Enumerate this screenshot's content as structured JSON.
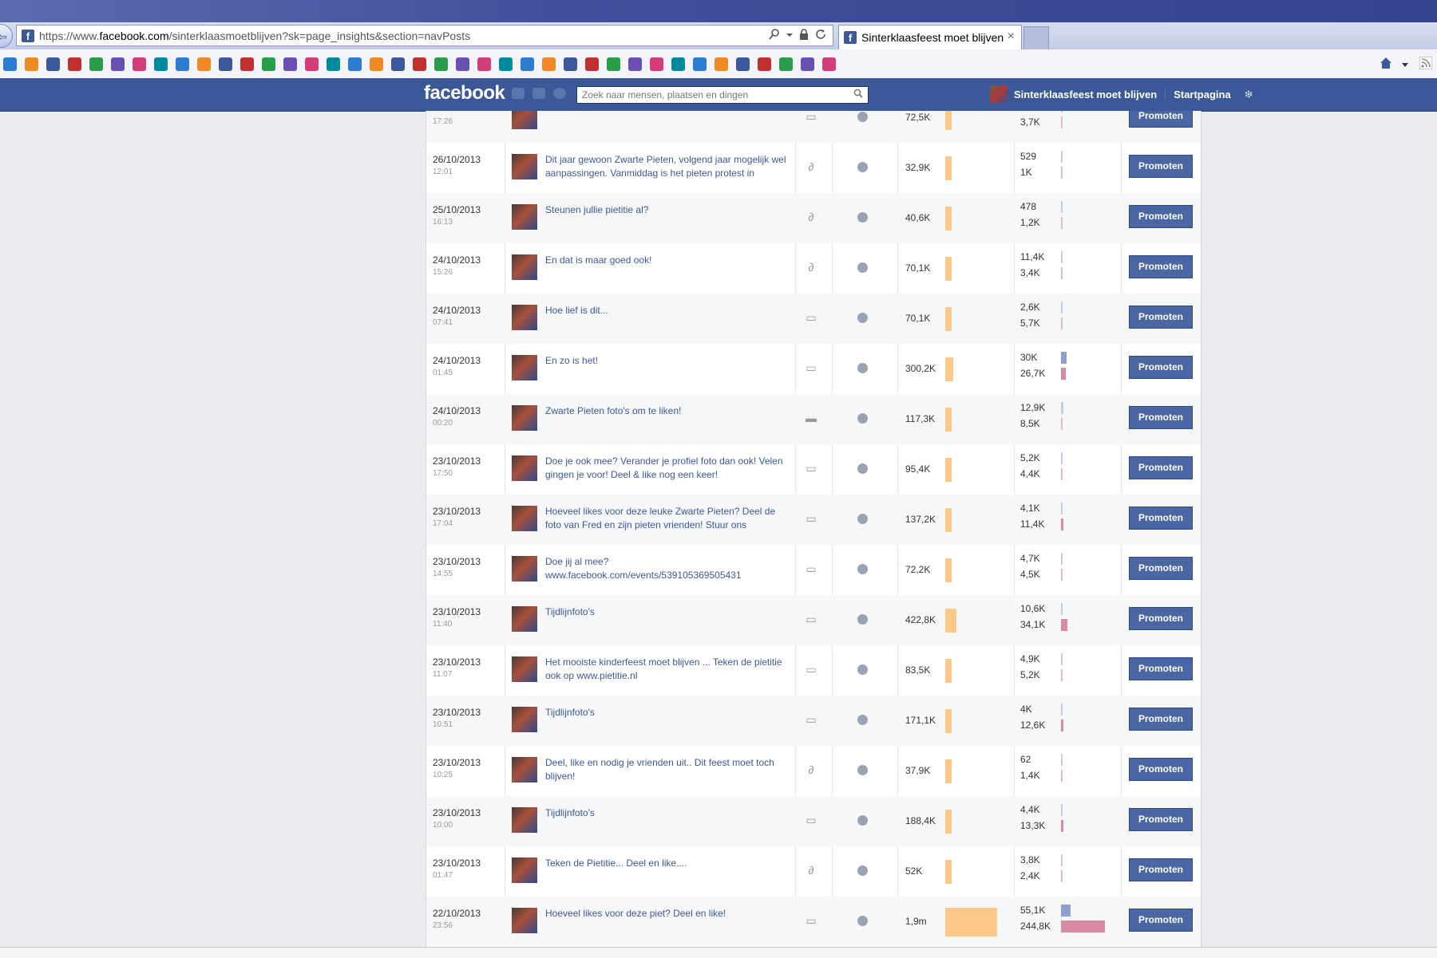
{
  "browser": {
    "back_glyph": "⇦",
    "url_pre": "https://www.",
    "url_host": "facebook.com",
    "url_post": "/sinterklaasmoetblijven?sk=page_insights&section=navPosts",
    "tab_title": "Sinterklaasfeest moet blijven",
    "tab_close": "×",
    "favicon_letter": "f",
    "favorites_icons": [
      "ie-page-icon",
      "ie-page-icon",
      "quickstart-icon",
      "ie-page-icon",
      "tools-icon",
      "facebook-icon",
      "ie-page-icon",
      "bookmark-icon",
      "parachute-icon",
      "cloud-icon",
      "cars-icon",
      "ie-page-icon",
      "ie-page-icon",
      "google-icon",
      "ie-page-icon",
      "feather-icon",
      "rtl-icon",
      "rtl-icon",
      "tile-icon",
      "globe-icon",
      "td-icon",
      "dx-icon",
      "ie-page-icon",
      "e-icon",
      "cp-icon",
      "basket-icon",
      "a-icon",
      "shield-icon",
      "info-icon",
      "fm-icon",
      "flower-icon",
      "fs-icon",
      "nl-icon",
      "flower-icon",
      "mail-icon",
      "google-icon",
      "chat-icon",
      "ie-page-icon",
      "facebook-icon"
    ]
  },
  "facebook_bar": {
    "logo": "facebook",
    "search_placeholder": "Zoek naar mensen, plaatsen en dingen",
    "page_name": "Sinterklaasfeest moet blijven",
    "home_link": "Startpagina"
  },
  "colors": {
    "fb_blue": "#3b5998",
    "reach_bar": "#fcc988",
    "engagement_bar_a": "#8e9fcf",
    "engagement_bar_b": "#d78aa2"
  },
  "posts": [
    {
      "date": "",
      "time": "17:26",
      "text": "",
      "type": "photo-icon",
      "reach": "72,5K",
      "reach_level": 0.02,
      "eng_a": "",
      "eng_a_level": 0,
      "eng_b": "3,7K",
      "eng_b_level": 0.015,
      "promote": "Promoten"
    },
    {
      "date": "26/10/2013",
      "time": "12:01",
      "text": "Dit jaar gewoon Zwarte Pieten, volgend jaar mogelijk wel aanpassingen. Vanmiddag is het pieten protest in",
      "type": "link-icon",
      "reach": "32,9K",
      "reach_level": 0.01,
      "eng_a": "529",
      "eng_a_level": 0.01,
      "eng_b": "1K",
      "eng_b_level": 0.004,
      "promote": "Promoten"
    },
    {
      "date": "25/10/2013",
      "time": "16:13",
      "text": "Steunen jullie pietitie al?",
      "type": "link-icon",
      "reach": "40,6K",
      "reach_level": 0.015,
      "eng_a": "478",
      "eng_a_level": 0.01,
      "eng_b": "1,2K",
      "eng_b_level": 0.005,
      "promote": "Promoten"
    },
    {
      "date": "24/10/2013",
      "time": "15:26",
      "text": "En dat is maar goed ook!",
      "type": "link-icon",
      "reach": "70,1K",
      "reach_level": 0.02,
      "eng_a": "11,4K",
      "eng_a_level": 0.2,
      "eng_b": "3,4K",
      "eng_b_level": 0.014,
      "promote": "Promoten"
    },
    {
      "date": "24/10/2013",
      "time": "07:41",
      "text": "Hoe lief is dit...",
      "type": "photo-icon",
      "reach": "70,1K",
      "reach_level": 0.02,
      "eng_a": "2,6K",
      "eng_a_level": 0.05,
      "eng_b": "5,7K",
      "eng_b_level": 0.023,
      "promote": "Promoten"
    },
    {
      "date": "24/10/2013",
      "time": "01:45",
      "text": "En zo is het!",
      "type": "photo-icon",
      "reach": "300,2K",
      "reach_level": 0.15,
      "eng_a": "30K",
      "eng_a_level": 0.55,
      "eng_b": "26,7K",
      "eng_b_level": 0.11,
      "promote": "Promoten"
    },
    {
      "date": "24/10/2013",
      "time": "00:20",
      "text": "Zwarte Pieten foto's om te liken!",
      "type": "status-icon",
      "reach": "117,3K",
      "reach_level": 0.05,
      "eng_a": "12,9K",
      "eng_a_level": 0.22,
      "eng_b": "8,5K",
      "eng_b_level": 0.035,
      "promote": "Promoten"
    },
    {
      "date": "23/10/2013",
      "time": "17:50",
      "text": "Doe je ook mee? Verander je profiel foto dan ook! Velen gingen je voor! Deel & like nog een keer!",
      "type": "photo-icon",
      "reach": "95,4K",
      "reach_level": 0.04,
      "eng_a": "5,2K",
      "eng_a_level": 0.09,
      "eng_b": "4,4K",
      "eng_b_level": 0.018,
      "promote": "Promoten"
    },
    {
      "date": "23/10/2013",
      "time": "17:04",
      "text": "Hoeveel likes voor deze leuke Zwarte Pieten? Deel de foto van Fred en zijn pieten vrienden! Stuur ons",
      "type": "photo-icon",
      "reach": "137,2K",
      "reach_level": 0.06,
      "eng_a": "4,1K",
      "eng_a_level": 0.07,
      "eng_b": "11,4K",
      "eng_b_level": 0.047,
      "promote": "Promoten"
    },
    {
      "date": "23/10/2013",
      "time": "14:55",
      "text": "Doe jij al mee? www.facebook.com/events/539105369505431",
      "type": "photo-icon",
      "reach": "72,2K",
      "reach_level": 0.02,
      "eng_a": "4,7K",
      "eng_a_level": 0.08,
      "eng_b": "4,5K",
      "eng_b_level": 0.019,
      "promote": "Promoten"
    },
    {
      "date": "23/10/2013",
      "time": "11:40",
      "text": "Tijdlijnfoto's",
      "type": "photo-icon",
      "reach": "422,8K",
      "reach_level": 0.21,
      "eng_a": "10,6K",
      "eng_a_level": 0.19,
      "eng_b": "34,1K",
      "eng_b_level": 0.14,
      "promote": "Promoten"
    },
    {
      "date": "23/10/2013",
      "time": "11:07",
      "text": "Het mooiste kinderfeest moet blijven ... Teken de pietitie ook op www.pietitie.nl",
      "type": "photo-icon",
      "reach": "83,5K",
      "reach_level": 0.03,
      "eng_a": "4,9K",
      "eng_a_level": 0.08,
      "eng_b": "5,2K",
      "eng_b_level": 0.021,
      "promote": "Promoten"
    },
    {
      "date": "23/10/2013",
      "time": "10:51",
      "text": "Tijdlijnfoto's",
      "type": "photo-icon",
      "reach": "171,1K",
      "reach_level": 0.08,
      "eng_a": "4K",
      "eng_a_level": 0.07,
      "eng_b": "12,6K",
      "eng_b_level": 0.052,
      "promote": "Promoten"
    },
    {
      "date": "23/10/2013",
      "time": "10:25",
      "text": "Deel, like en nodig je vrienden uit.. Dit feest moet toch blijven!",
      "type": "link-icon",
      "reach": "37,9K",
      "reach_level": 0.01,
      "eng_a": "62",
      "eng_a_level": 0.005,
      "eng_b": "1,4K",
      "eng_b_level": 0.006,
      "promote": "Promoten"
    },
    {
      "date": "23/10/2013",
      "time": "10:00",
      "text": "Tijdlijnfoto's",
      "type": "photo-icon",
      "reach": "188,4K",
      "reach_level": 0.09,
      "eng_a": "4,4K",
      "eng_a_level": 0.08,
      "eng_b": "13,3K",
      "eng_b_level": 0.055,
      "promote": "Promoten"
    },
    {
      "date": "23/10/2013",
      "time": "01:47",
      "text": "Teken de Pietitie... Deel en like....",
      "type": "link-icon",
      "reach": "52K",
      "reach_level": 0.015,
      "eng_a": "3,8K",
      "eng_a_level": 0.07,
      "eng_b": "2,4K",
      "eng_b_level": 0.01,
      "promote": "Promoten"
    },
    {
      "date": "22/10/2013",
      "time": "23:56",
      "text": "Hoeveel likes voor deze piet? Deel en like!",
      "type": "photo-icon",
      "reach": "1,9m",
      "reach_level": 1.0,
      "eng_a": "55,1K",
      "eng_a_level": 1.0,
      "eng_b": "244,8K",
      "eng_b_level": 1.0,
      "promote": "Promoten"
    }
  ]
}
